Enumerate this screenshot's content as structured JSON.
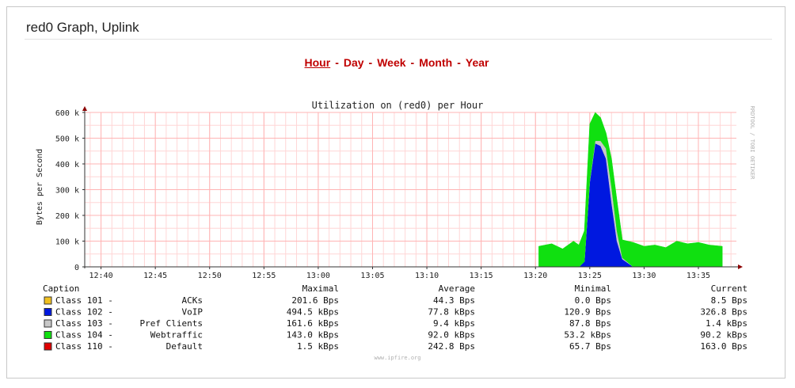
{
  "panel": {
    "title": "red0 Graph, Uplink"
  },
  "nav": {
    "periods": [
      "Hour",
      "Day",
      "Week",
      "Month",
      "Year"
    ],
    "active": "Hour"
  },
  "graph": {
    "watermark": "RRDTOOL / TOBI OETIKER",
    "footer": "www.ipfire.org",
    "colors": {
      "background": "#ffffff",
      "grid": "#ffb4b4",
      "gridMinor": "#ffd6d6",
      "axis": "#8b0000"
    }
  },
  "legend": {
    "headers": {
      "caption": "Caption",
      "max": "Maximal",
      "avg": "Average",
      "min": "Minimal",
      "cur": "Current"
    },
    "rows": [
      {
        "cls": "Class 101 -",
        "name": "ACKs",
        "max": "201.6  Bps",
        "avg": "44.3  Bps",
        "min": "0.0  Bps",
        "cur": "8.5  Bps",
        "color": "#f0c020"
      },
      {
        "cls": "Class 102 -",
        "name": "VoIP",
        "max": "494.5 kBps",
        "avg": "77.8 kBps",
        "min": "120.9  Bps",
        "cur": "326.8  Bps",
        "color": "#0018e0"
      },
      {
        "cls": "Class 103 -",
        "name": "Pref Clients",
        "max": "161.6 kBps",
        "avg": "9.4 kBps",
        "min": "87.8  Bps",
        "cur": "1.4 kBps",
        "color": "#c8c8c8"
      },
      {
        "cls": "Class 104 -",
        "name": "Webtraffic",
        "max": "143.0 kBps",
        "avg": "92.0 kBps",
        "min": "53.2 kBps",
        "cur": "90.2 kBps",
        "color": "#10e010"
      },
      {
        "cls": "Class 110 -",
        "name": "Default",
        "max": "1.5 kBps",
        "avg": "242.8  Bps",
        "min": "65.7  Bps",
        "cur": "163.0  Bps",
        "color": "#e00000"
      }
    ]
  },
  "chart_data": {
    "type": "area",
    "title": "Utilization on (red0) per Hour",
    "xlabel": "",
    "ylabel": "Bytes per Second",
    "x_ticks": [
      "12:40",
      "12:45",
      "12:50",
      "12:55",
      "13:00",
      "13:05",
      "13:10",
      "13:15",
      "13:20",
      "13:25",
      "13:30",
      "13:35"
    ],
    "x_tick_minutes": [
      0,
      5,
      10,
      15,
      20,
      25,
      30,
      35,
      40,
      45,
      50,
      55
    ],
    "x_range_minutes": [
      -1.5,
      58.5
    ],
    "y_ticks": [
      0,
      100,
      200,
      300,
      400,
      500,
      600
    ],
    "y_tick_labels": [
      "0",
      "100 k",
      "200 k",
      "300 k",
      "400 k",
      "500 k",
      "600 k"
    ],
    "ylim": [
      0,
      600
    ],
    "y_units": "k Bytes per Second",
    "stacked": true,
    "grid": true,
    "x": [
      40.3,
      41.5,
      42.5,
      43.5,
      44.0,
      44.5,
      45.0,
      45.5,
      46.0,
      46.5,
      47.0,
      47.5,
      48.0,
      49.0,
      50.0,
      51.0,
      52.0,
      53.0,
      54.0,
      55.0,
      56.0,
      57.2
    ],
    "series": [
      {
        "name": "Class 102",
        "color": "#0018e0",
        "values": [
          0,
          0,
          0,
          0,
          0,
          20,
          330,
          480,
          470,
          420,
          250,
          100,
          30,
          0,
          0,
          0,
          0,
          0,
          0,
          0,
          0,
          0
        ]
      },
      {
        "name": "Class 103",
        "color": "#c8c8c8",
        "values": [
          0,
          0,
          0,
          0,
          0,
          0,
          5,
          10,
          20,
          40,
          60,
          40,
          5,
          0,
          0,
          0,
          0,
          0,
          0,
          0,
          0,
          0
        ]
      },
      {
        "name": "Class 104",
        "color": "#10e010",
        "values": [
          80,
          90,
          70,
          100,
          85,
          120,
          220,
          110,
          90,
          60,
          110,
          120,
          70,
          95,
          80,
          85,
          75,
          100,
          90,
          95,
          85,
          80
        ]
      }
    ]
  }
}
